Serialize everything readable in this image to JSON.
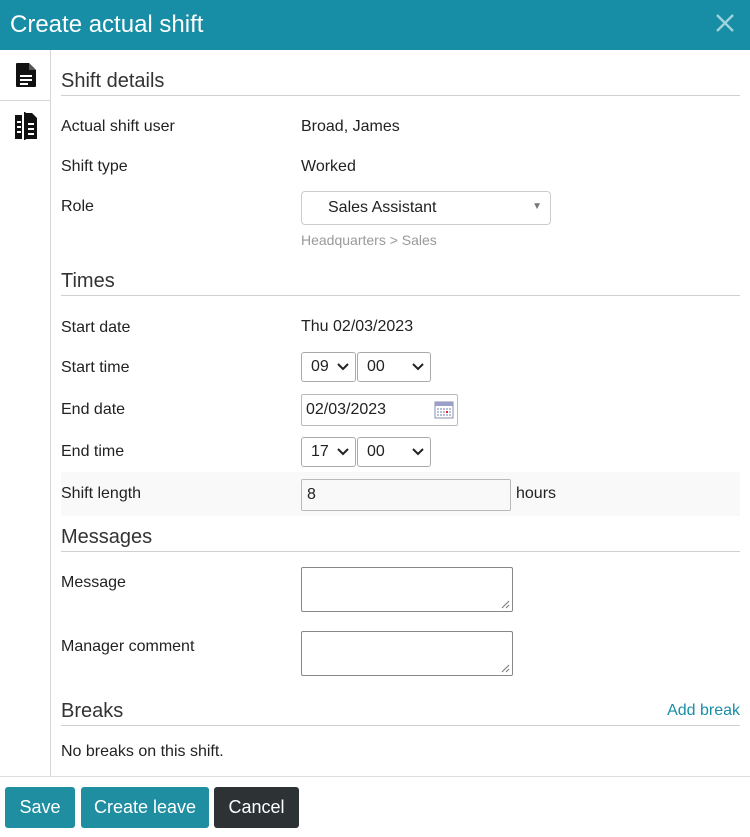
{
  "header": {
    "title": "Create actual shift"
  },
  "sidebar": {
    "tabs": [
      {
        "icon": "document-icon"
      },
      {
        "icon": "clone-document-icon"
      }
    ]
  },
  "sections": {
    "shift_details": {
      "title": "Shift details",
      "user_label": "Actual shift user",
      "user_value": "Broad, James",
      "type_label": "Shift type",
      "type_value": "Worked",
      "role_label": "Role",
      "role_value": "Sales Assistant",
      "role_hint": "Headquarters > Sales"
    },
    "times": {
      "title": "Times",
      "start_date_label": "Start date",
      "start_date_value": "Thu 02/03/2023",
      "start_time_label": "Start time",
      "start_hour": "09",
      "start_minute": "00",
      "end_date_label": "End date",
      "end_date_value": "02/03/2023",
      "end_time_label": "End time",
      "end_hour": "17",
      "end_minute": "00",
      "length_label": "Shift length",
      "length_value": "8",
      "length_unit": "hours"
    },
    "messages": {
      "title": "Messages",
      "message_label": "Message",
      "manager_label": "Manager comment"
    },
    "breaks": {
      "title": "Breaks",
      "add_link": "Add break",
      "empty_text": "No breaks on this shift."
    }
  },
  "footer": {
    "save": "Save",
    "create_leave": "Create leave",
    "cancel": "Cancel"
  }
}
